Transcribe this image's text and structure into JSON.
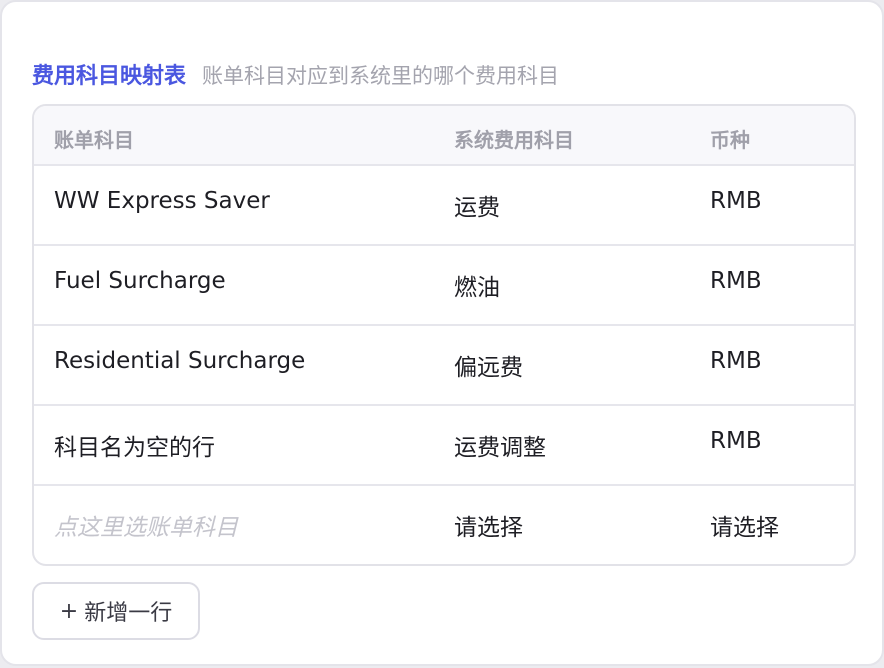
{
  "header": {
    "title": "费用科目映射表",
    "subtitle": "账单科目对应到系统里的哪个费用科目"
  },
  "table": {
    "columns": [
      "账单科目",
      "系统费用科目",
      "币种"
    ],
    "rows": [
      {
        "bill_item": "WW Express Saver",
        "system_item": "运费",
        "currency": "RMB"
      },
      {
        "bill_item": "Fuel Surcharge",
        "system_item": "燃油",
        "currency": "RMB"
      },
      {
        "bill_item": "Residential Surcharge",
        "system_item": "偏远费",
        "currency": "RMB"
      },
      {
        "bill_item": "科目名为空的行",
        "system_item": "运费调整",
        "currency": "RMB"
      }
    ],
    "new_row": {
      "bill_item_placeholder": "点这里选账单科目",
      "system_item": "请选择",
      "currency": "请选择"
    }
  },
  "actions": {
    "add_row_icon": "+",
    "add_row_label": "新增一行"
  }
}
